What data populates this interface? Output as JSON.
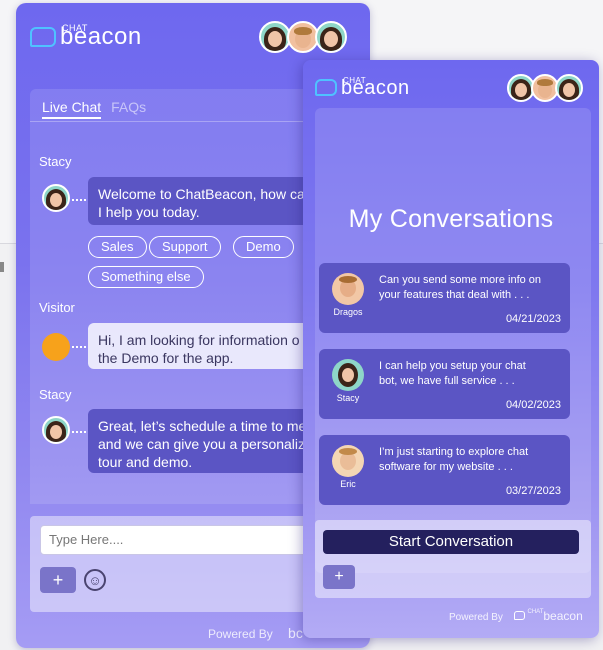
{
  "back_widget": {
    "logo": {
      "small": "CHAT",
      "big": "beacon"
    },
    "tabs": {
      "live_chat": "Live Chat",
      "faqs": "FAQs"
    },
    "messages": [
      {
        "sender": "Stacy",
        "text_1": "Welcome to ChatBeacon, how ca",
        "text_2": "I help you today."
      },
      {
        "sender": "Visitor",
        "text_1": "Hi, I am looking for information o",
        "text_2": "the Demo for the app."
      },
      {
        "sender": "Stacy",
        "text_1": "Great, let’s schedule a time to me",
        "text_2": "and we can give you a personaliz",
        "text_3": "tour and demo."
      }
    ],
    "quick_replies": [
      "Sales",
      "Support",
      "Demo",
      "Something else"
    ],
    "input_placeholder": "Type Here....",
    "add_label": "+",
    "emoji_label": "☺",
    "powered_by": "Powered By",
    "powered_logo": "bc"
  },
  "front_widget": {
    "logo": {
      "small": "CHAT",
      "big": "beacon"
    },
    "title": "My Conversations",
    "conversations": [
      {
        "name": "Dragos",
        "preview": "Can you send some more info on\nyour features that deal with . . .",
        "date": "04/21/2023"
      },
      {
        "name": "Stacy",
        "preview": "I can help you setup your chat\nbot, we have full service . . .",
        "date": "04/02/2023"
      },
      {
        "name": "Eric",
        "preview": "I’m just starting to explore chat\nsoftware for my website . . .",
        "date": "03/27/2023"
      }
    ],
    "start_label": "Start Conversation",
    "add_label": "+",
    "powered_by": "Powered By",
    "powered_logo_small": "CHAT",
    "powered_logo_big": "beacon"
  },
  "colors": {
    "accent": "#6e68ef",
    "bubble_agent": "#5b55c4",
    "start_button": "#24205e",
    "visitor_dot": "#f7a21b",
    "logo_bubble": "#4fc2ff"
  }
}
